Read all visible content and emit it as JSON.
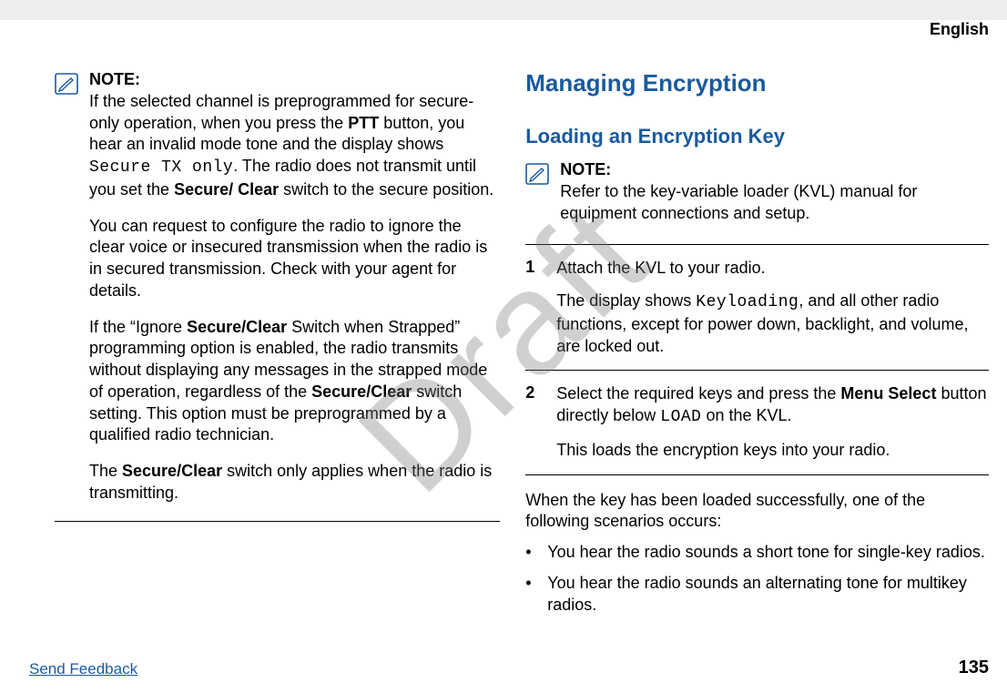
{
  "header": {
    "language": "English"
  },
  "watermark": "Draft",
  "left": {
    "note_label": "NOTE:",
    "p1a": "If the selected channel is preprogrammed for secure-only operation, when you press the ",
    "p1b": "PTT",
    "p1c": " button, you hear an invalid mode tone and the display shows ",
    "p1d": "Secure TX only",
    "p1e": ". The radio does not transmit until you set the ",
    "p1f": "Secure/ Clear",
    "p1g": " switch to the secure position.",
    "p2": "You can request to configure the radio to ignore the clear voice or insecured transmission when the radio is in secured transmission. Check with your agent for details.",
    "p3a": "If the “Ignore ",
    "p3b": "Secure/Clear",
    "p3c": " Switch when Strapped” programming option is enabled, the radio transmits without displaying any messages in the strapped mode of operation, regardless of the ",
    "p3d": "Secure/Clear",
    "p3e": " switch setting. This option must be preprogrammed by a qualified radio technician.",
    "p4a": "The ",
    "p4b": "Secure/Clear",
    "p4c": " switch only applies when the radio is transmitting."
  },
  "right": {
    "h1": "Managing Encryption",
    "h2": "Loading an Encryption Key",
    "note_label": "NOTE:",
    "note_body": "Refer to the key-variable loader (KVL) manual for equipment connections and setup.",
    "steps": [
      {
        "num": "1",
        "p1": "Attach the KVL to your radio.",
        "p2a": "The display shows ",
        "p2b": "Keyloading",
        "p2c": ", and all other radio functions, except for power down, backlight, and volume, are locked out."
      },
      {
        "num": "2",
        "p1a": "Select the required keys and press the ",
        "p1b": "Menu Select",
        "p1c": " button directly below ",
        "p1d": "LOAD",
        "p1e": " on the KVL.",
        "p2": "This loads the encryption keys into your radio."
      }
    ],
    "after": "When the key has been loaded successfully, one of the following scenarios occurs:",
    "bullets": [
      "You hear the radio sounds a short tone for single-key radios.",
      "You hear the radio sounds an alternating tone for multikey radios."
    ]
  },
  "footer": {
    "send_feedback": "Send Feedback",
    "page": "135"
  }
}
